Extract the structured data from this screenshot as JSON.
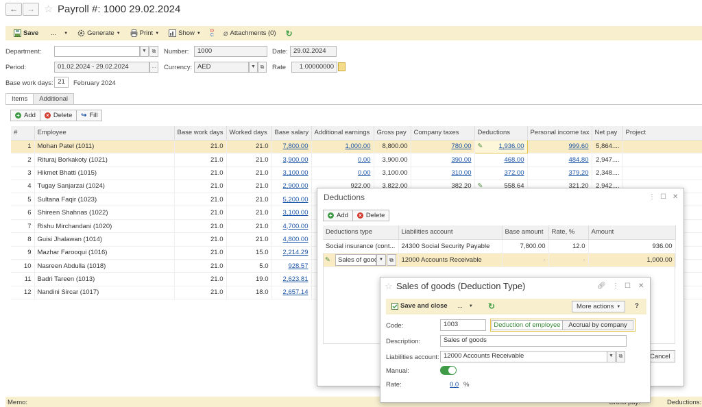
{
  "header": {
    "back_icon": "←",
    "forward_icon": "→",
    "star_icon": "☆",
    "title": "Payroll #: 1000 29.02.2024"
  },
  "toolbar": {
    "save": "Save",
    "more": "...",
    "generate": "Generate",
    "print": "Print",
    "show": "Show",
    "attachments": "Attachments (0)"
  },
  "form": {
    "department_label": "Department:",
    "department_value": "",
    "number_label": "Number:",
    "number_value": "1000",
    "date_label": "Date:",
    "date_value": "29.02.2024",
    "period_label": "Period:",
    "period_value": "01.02.2024 - 29.02.2024",
    "currency_label": "Currency:",
    "currency_value": "AED",
    "rate_label": "Rate",
    "rate_value": "1.00000000",
    "base_work_days_label": "Base work days:",
    "base_work_days_value": "21",
    "base_work_days_month": "February 2024"
  },
  "tabs": [
    "Items",
    "Additional"
  ],
  "items_toolbar": {
    "add": "Add",
    "delete": "Delete",
    "fill": "Fill"
  },
  "grid": {
    "columns": [
      "#",
      "Employee",
      "Base work days",
      "Worked days",
      "Base salary",
      "Additional earnings",
      "Gross pay",
      "Company taxes",
      "Deductions",
      "Personal income tax",
      "Net pay",
      "Project"
    ],
    "rows": [
      [
        "1",
        "Mohan Patel (1011)",
        "21.0",
        "21.0",
        "7,800.00",
        "1,000.00",
        "8,800.00",
        "780.00",
        "1,936.00",
        "999.60",
        "5,864....",
        ""
      ],
      [
        "2",
        "Rituraj Borkakoty (1021)",
        "21.0",
        "21.0",
        "3,900.00",
        "0.00",
        "3,900.00",
        "390.00",
        "468.00",
        "484.80",
        "2,947....",
        ""
      ],
      [
        "3",
        "Hikmet Bhatti (1015)",
        "21.0",
        "21.0",
        "3,100.00",
        "0.00",
        "3,100.00",
        "310.00",
        "372.00",
        "379.20",
        "2,348....",
        ""
      ],
      [
        "4",
        "Tugay Sanjarzai (1024)",
        "21.0",
        "21.0",
        "2,900.00",
        "922.00",
        "3,822.00",
        "382.20",
        "558.64",
        "321.20",
        "2,942....",
        ""
      ],
      [
        "5",
        "Sultana Faqir (1023)",
        "21.0",
        "21.0",
        "5,200.00",
        "",
        "",
        "",
        "",
        "",
        "",
        ""
      ],
      [
        "6",
        "Shireen Shahnas (1022)",
        "21.0",
        "21.0",
        "3,100.00",
        "",
        "",
        "",
        "",
        "",
        "",
        ""
      ],
      [
        "7",
        "Rishu Mirchandani (1020)",
        "21.0",
        "21.0",
        "4,700.00",
        "",
        "",
        "",
        "",
        "",
        "",
        ""
      ],
      [
        "8",
        "Guisi Jhalawan (1014)",
        "21.0",
        "21.0",
        "4,800.00",
        "",
        "",
        "",
        "",
        "",
        "",
        ""
      ],
      [
        "9",
        "Mazhar Farooqui (1016)",
        "21.0",
        "15.0",
        "2,214.29",
        "",
        "",
        "",
        "",
        "",
        "",
        ""
      ],
      [
        "10",
        "Nasreen Abdulla (1018)",
        "21.0",
        "5.0",
        "928.57",
        "",
        "",
        "",
        "",
        "",
        "",
        ""
      ],
      [
        "11",
        "Badri Tareen (1013)",
        "21.0",
        "19.0",
        "2,623.81",
        "",
        "",
        "",
        "",
        "",
        "",
        ""
      ],
      [
        "12",
        "Nandini Sircar (1017)",
        "21.0",
        "18.0",
        "2,657.14",
        "",
        "",
        "",
        "",
        "",
        "",
        ""
      ]
    ]
  },
  "footer": {
    "memo": "Memo:",
    "gross_pay": "Gross pay:",
    "deductions": "Deductions:"
  },
  "deductions_window": {
    "title": "Deductions",
    "add": "Add",
    "delete": "Delete",
    "columns": [
      "Deductions type",
      "Liabilities account",
      "Base amount",
      "Rate, %",
      "Amount"
    ],
    "rows": [
      {
        "type": "Social insurance (cont...",
        "account": "24300 Social Security Payable",
        "base": "7,800.00",
        "rate": "12.0",
        "amount": "936.00"
      },
      {
        "type": "Sales of good",
        "account": "12000 Accounts Receivable",
        "base": "-",
        "rate": "-",
        "amount": "1,000.00"
      }
    ],
    "cancel": "Cancel"
  },
  "type_window": {
    "title": "Sales of goods (Deduction Type)",
    "save_close": "Save and close",
    "more": "...",
    "more_actions": "More actions",
    "help": "?",
    "code_label": "Code:",
    "code_value": "1003",
    "toggle_employee": "Deduction of employee",
    "toggle_company": "Accrual by company",
    "description_label": "Description:",
    "description_value": "Sales of goods",
    "account_label": "Liabilities account:",
    "account_value": "12000 Accounts Receivable",
    "manual_label": "Manual:",
    "rate_label": "Rate:",
    "rate_value": "0.0",
    "rate_unit": "%"
  }
}
